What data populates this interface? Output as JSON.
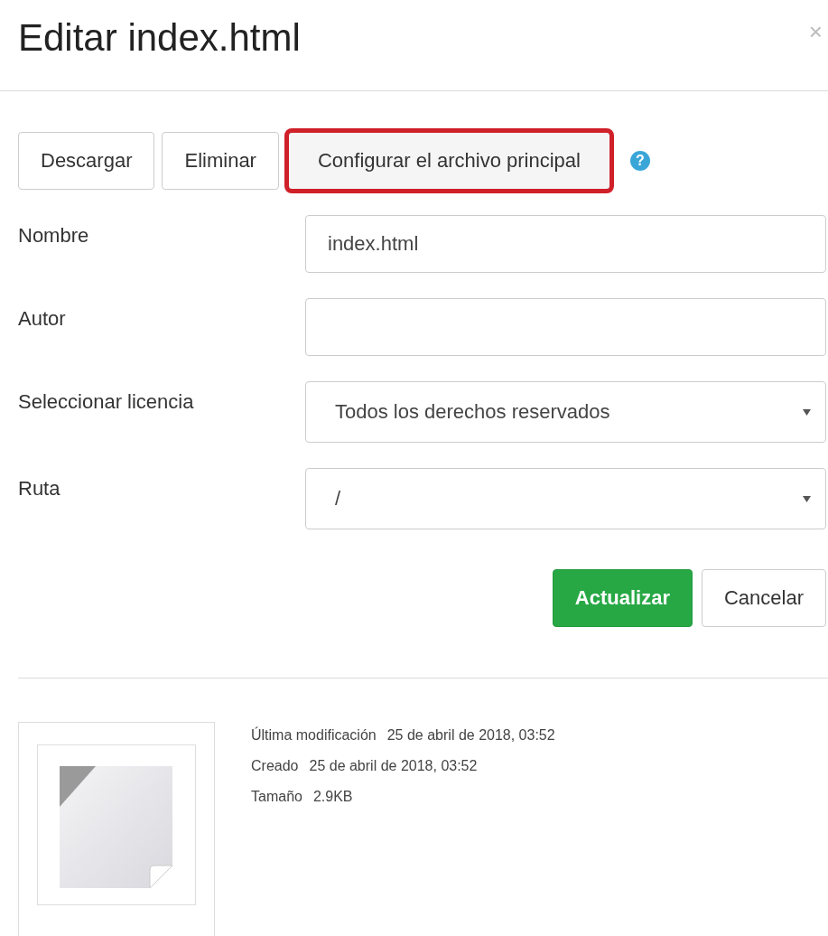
{
  "dialog": {
    "title": "Editar index.html",
    "close": "×"
  },
  "actions": [
    {
      "label": "Descargar",
      "highlighted": false
    },
    {
      "label": "Eliminar",
      "highlighted": false
    },
    {
      "label": "Configurar el archivo principal",
      "highlighted": true
    }
  ],
  "help": "?",
  "fields": [
    {
      "label": "Nombre",
      "kind": "text",
      "value": "index.html"
    },
    {
      "label": "Autor",
      "kind": "text"
    },
    {
      "label": "Seleccionar licencia",
      "kind": "select",
      "value": "Todos los derechos reservados"
    },
    {
      "label": "Ruta",
      "kind": "select",
      "value": "/"
    }
  ],
  "buttons": [
    {
      "label": "Actualizar",
      "kind": "primary"
    },
    {
      "label": "Cancelar",
      "kind": "default"
    }
  ],
  "info": [
    {
      "label": "Última modificación",
      "value": "25 de abril de 2018, 03:52"
    },
    {
      "label": "Creado",
      "value": "25 de abril de 2018, 03:52"
    },
    {
      "label": "Tamaño",
      "value": "2.9KB"
    }
  ]
}
